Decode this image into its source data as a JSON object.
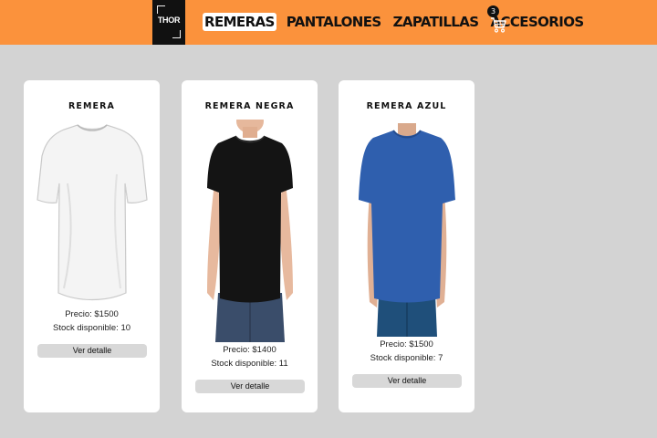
{
  "header": {
    "logo_text": "THOR",
    "nav": [
      {
        "label": "REMERAS",
        "active": true
      },
      {
        "label": "PANTALONES",
        "active": false
      },
      {
        "label": "ZAPATILLAS",
        "active": false
      },
      {
        "label": "ACCESORIOS",
        "active": false
      }
    ],
    "cart_count": "3"
  },
  "products": [
    {
      "title": "REMERA",
      "price": "Precio: $1500",
      "stock": "Stock disponible: 10",
      "button": "Ver detalle",
      "shirt_color": "#f4f4f4"
    },
    {
      "title": "REMERA NEGRA",
      "price": "Precio: $1400",
      "stock": "Stock disponible: 11",
      "button": "Ver detalle",
      "shirt_color": "#141414"
    },
    {
      "title": "REMERA AZUL",
      "price": "Precio: $1500",
      "stock": "Stock disponible: 7",
      "button": "Ver detalle",
      "shirt_color": "#2f5fae"
    }
  ],
  "colors": {
    "navbar": "#fb923c",
    "background": "#d3d3d3",
    "card": "#ffffff",
    "button": "#d8d8d8"
  }
}
